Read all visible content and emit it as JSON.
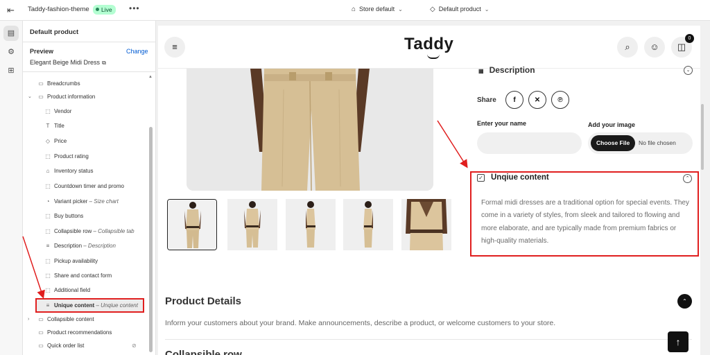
{
  "topbar": {
    "theme_name": "Taddy-fashion-theme",
    "live_label": "Live",
    "more_label": "•••",
    "store_picker": "Store default",
    "template_picker": "Default product"
  },
  "sidebar": {
    "title": "Default product",
    "preview_label": "Preview",
    "change_label": "Change",
    "preview_product": "Elegant Beige Midi Dress",
    "items": [
      {
        "label": "Breadcrumbs",
        "sub": "",
        "icon": "section-icon"
      },
      {
        "label": "Product information",
        "sub": "",
        "icon": "section-icon"
      },
      {
        "label": "Vendor",
        "sub": "",
        "icon": "block-icon"
      },
      {
        "label": "Title",
        "sub": "",
        "icon": "text-icon"
      },
      {
        "label": "Price",
        "sub": "",
        "icon": "tag-icon"
      },
      {
        "label": "Product rating",
        "sub": "",
        "icon": "block-icon"
      },
      {
        "label": "Inventory status",
        "sub": "",
        "icon": "inventory-icon"
      },
      {
        "label": "Countdown timer and promo",
        "sub": "",
        "icon": "block-icon"
      },
      {
        "label": "Variant picker",
        "sub": "Size chart",
        "icon": "variant-icon"
      },
      {
        "label": "Buy buttons",
        "sub": "",
        "icon": "block-icon"
      },
      {
        "label": "Collapsible row",
        "sub": "Collapsible tab",
        "icon": "block-icon"
      },
      {
        "label": "Description",
        "sub": "Description",
        "icon": "lines-icon"
      },
      {
        "label": "Pickup availability",
        "sub": "",
        "icon": "block-icon"
      },
      {
        "label": "Share and contact form",
        "sub": "",
        "icon": "block-icon"
      },
      {
        "label": "Additional field",
        "sub": "",
        "icon": "block-icon"
      },
      {
        "label": "Unique content",
        "sub": "Unqiue content",
        "icon": "lines-icon"
      },
      {
        "label": "Collapsible content",
        "sub": "",
        "icon": "section-icon"
      },
      {
        "label": "Product recommendations",
        "sub": "",
        "icon": "section-icon"
      },
      {
        "label": "Quick order list",
        "sub": "",
        "icon": "section-icon"
      }
    ]
  },
  "store": {
    "logo": "Taddy",
    "cart_count": "0",
    "description_heading": "Description",
    "share_label": "Share",
    "share_buttons": [
      "facebook",
      "x",
      "pinterest"
    ],
    "name_label": "Enter your name",
    "image_label": "Add your image",
    "choose_file": "Choose File",
    "no_file": "No file chosen",
    "unique_title": "Unqiue content",
    "unique_body": "Formal midi dresses are a traditional option for special events. They come in a variety of styles, from sleek and tailored to flowing and more elaborate, and are typically made from premium fabrics or high-quality materials.",
    "product_details_title": "Product Details",
    "product_details_text": "Inform your customers about your brand. Make announcements, describe a product, or welcome customers to your store.",
    "collapsible_title": "Collapsible row"
  },
  "colors": {
    "accent_red": "#e01e1e",
    "link_blue": "#005bd3",
    "live_green": "#b4fed2",
    "beige": "#d8c29a"
  }
}
